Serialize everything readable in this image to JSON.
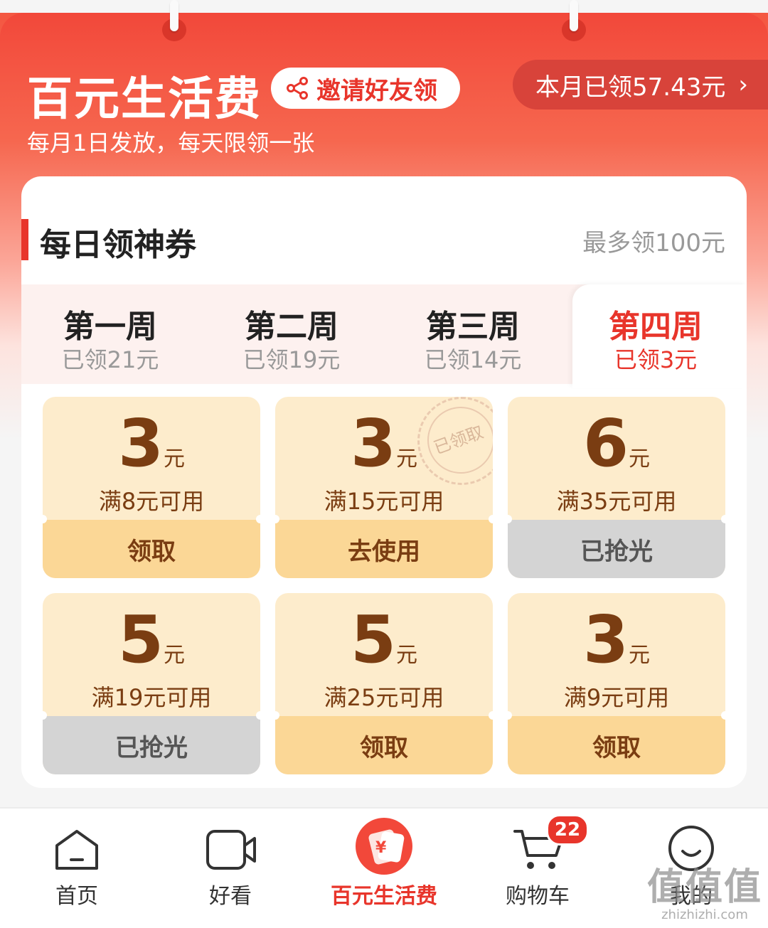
{
  "header": {
    "title": "百元生活费",
    "invite_label": "邀请好友领",
    "month_claimed": "本月已领57.43元",
    "month_chevron": "›",
    "subtitle": "每月1日发放，每天限领一张"
  },
  "section": {
    "title": "每日领神券",
    "max_note": "最多领100元"
  },
  "weeks": [
    {
      "name": "第一周",
      "claimed": "已领21元"
    },
    {
      "name": "第二周",
      "claimed": "已领19元"
    },
    {
      "name": "第三周",
      "claimed": "已领14元"
    },
    {
      "name": "第四周",
      "claimed": "已领3元"
    }
  ],
  "coupons": [
    {
      "amount": "3",
      "unit": "元",
      "condition": "满8元可用",
      "action": "领取"
    },
    {
      "amount": "3",
      "unit": "元",
      "condition": "满15元可用",
      "action": "去使用",
      "stamp": "已领取"
    },
    {
      "amount": "6",
      "unit": "元",
      "condition": "满35元可用",
      "action": "已抢光"
    },
    {
      "amount": "5",
      "unit": "元",
      "condition": "满19元可用",
      "action": "已抢光"
    },
    {
      "amount": "5",
      "unit": "元",
      "condition": "满25元可用",
      "action": "领取"
    },
    {
      "amount": "3",
      "unit": "元",
      "condition": "满9元可用",
      "action": "领取"
    }
  ],
  "tabbar": {
    "items": [
      {
        "label": "首页",
        "icon": "home-icon"
      },
      {
        "label": "好看",
        "icon": "video-icon"
      },
      {
        "label": "百元生活费",
        "icon": "living-allowance-icon"
      },
      {
        "label": "购物车",
        "icon": "cart-icon"
      },
      {
        "label": "我的",
        "icon": "profile-icon"
      }
    ],
    "cart_badge": "22"
  },
  "watermark": {
    "big": "值值值",
    "small": "zhizhizhi.com"
  },
  "colors": {
    "accent": "#e8352b",
    "coupon_bg": "#fdeccc",
    "coupon_btn": "#fbd796",
    "coupon_text": "#7a3d12",
    "disabled_btn": "#d4d4d4"
  }
}
